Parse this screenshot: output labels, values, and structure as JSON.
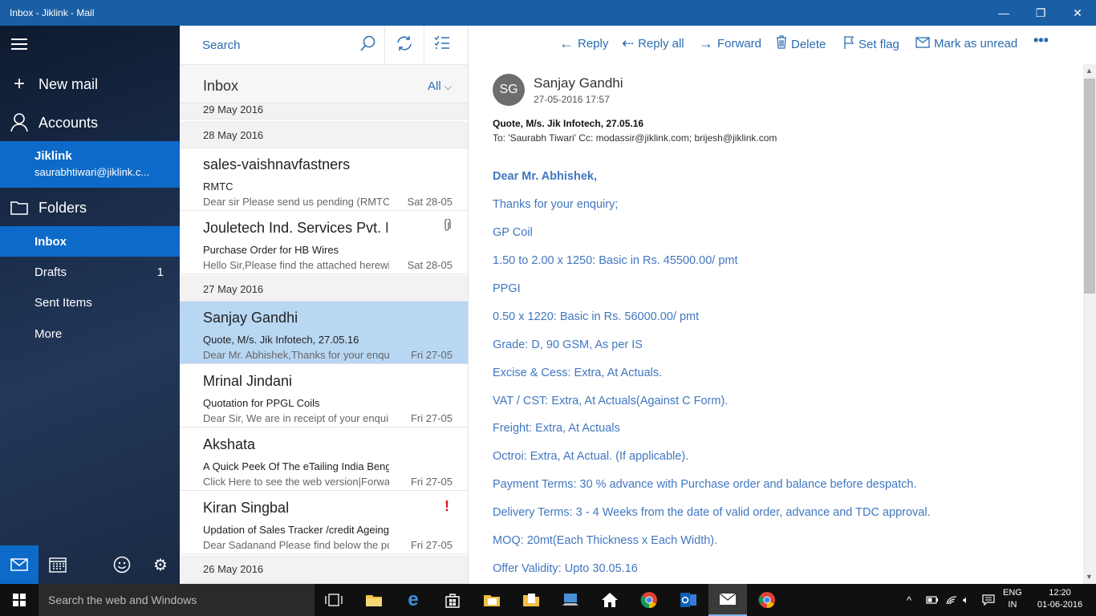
{
  "window": {
    "title": "Inbox - Jiklink - Mail"
  },
  "nav": {
    "new_mail": "New mail",
    "accounts": "Accounts",
    "account_name": "Jiklink",
    "account_email": "saurabhtiwari@jiklink.c...",
    "folders_label": "Folders",
    "folders": [
      {
        "label": "Inbox",
        "count": ""
      },
      {
        "label": "Drafts",
        "count": "1"
      },
      {
        "label": "Sent Items",
        "count": ""
      },
      {
        "label": "More",
        "count": ""
      }
    ]
  },
  "list": {
    "search_placeholder": "Search",
    "folder_title": "Inbox",
    "filter": "All",
    "groups": [
      "29 May 2016",
      "28 May 2016",
      "27 May 2016",
      "26 May 2016"
    ],
    "messages": [
      {
        "from": "sales-vaishnavfastners",
        "subject": "RMTC",
        "preview": "Dear sir Please send us pending (RMTC)",
        "date": "Sat 28-05"
      },
      {
        "from": "Jouletech Ind. Services Pvt. Ltd.",
        "subject": "Purchase Order for HB Wires",
        "preview": "Hello Sir,Please find the attached herewith",
        "date": "Sat 28-05",
        "attachment_icon": "paperclip-icon"
      },
      {
        "from": "Sanjay Gandhi",
        "subject": "Quote, M/s. Jik Infotech, 27.05.16",
        "preview": "Dear Mr. Abhishek,Thanks for your enquiry",
        "date": "Fri 27-05",
        "selected": true
      },
      {
        "from": "Mrinal Jindani",
        "subject": "Quotation for PPGL Coils",
        "preview": "Dear Sir, We are in receipt of your enquiry",
        "date": "Fri 27-05"
      },
      {
        "from": "Akshata",
        "subject": "A Quick Peek Of The eTailing India Bengaluru",
        "preview": "Click Here to see the web version|Forward",
        "date": "Fri 27-05"
      },
      {
        "from": "Kiran Singbal",
        "subject": "Updation of Sales Tracker /credit Ageing",
        "preview": "Dear Sadanand Please find below the pos",
        "date": "Fri 27-05",
        "flag": "!"
      }
    ]
  },
  "toolbar": {
    "reply": "Reply",
    "reply_all": "Reply all",
    "forward": "Forward",
    "delete": "Delete",
    "set_flag": "Set flag",
    "mark_unread": "Mark as unread",
    "more": "•••"
  },
  "message": {
    "avatar_initials": "SG",
    "sender": "Sanjay Gandhi",
    "sent": "27-05-2016 17:57",
    "subject": "Quote, M/s. Jik Infotech, 27.05.16",
    "to_line": "To: 'Saurabh Tiwari' Cc: modassir@jiklink.com; brijesh@jiklink.com",
    "body": [
      "Dear Mr. Abhishek,",
      "Thanks for your enquiry;",
      "GP Coil",
      "1.50 to 2.00 x 1250: Basic in Rs. 45500.00/ pmt",
      "PPGI",
      "0.50 x 1220: Basic in Rs. 56000.00/ pmt",
      "Grade: D, 90 GSM, As per IS",
      "Excise & Cess: Extra, At Actuals.",
      "VAT / CST: Extra, At Actuals(Against C Form).",
      "Freight: Extra, At Actuals",
      "Octroi: Extra, At Actual. (If applicable).",
      "Payment Terms: 30 % advance with Purchase order and balance before despatch.",
      "Delivery Terms:  3 - 4 Weeks from the date of valid order, advance and TDC approval.",
      "MOQ: 20mt(Each Thickness x Each Width).",
      "Offer Validity: Upto 30.05.16"
    ]
  },
  "taskbar": {
    "search": "Search the web and Windows",
    "lang_top": "ENG",
    "lang_bottom": "IN",
    "time": "12:20",
    "date": "01-06-2016"
  }
}
